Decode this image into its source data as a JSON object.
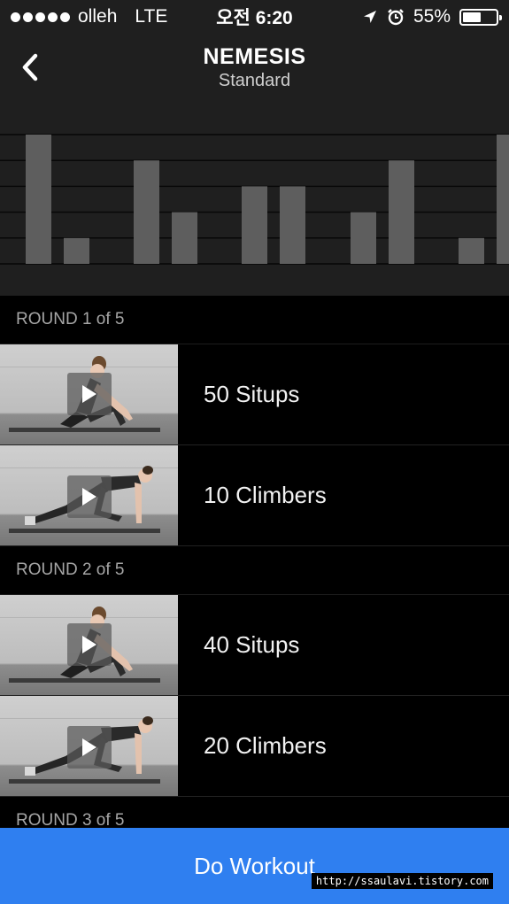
{
  "status_bar": {
    "carrier": "olleh",
    "network": "LTE",
    "time": "오전 6:20",
    "battery": "55%",
    "battery_level": 0.55,
    "icons": [
      "signal-dots-icon",
      "location-arrow-icon",
      "alarm-icon",
      "battery-icon"
    ]
  },
  "header": {
    "title": "NEMESIS",
    "subtitle": "Standard",
    "back_icon": "chevron-left-icon"
  },
  "chart_data": {
    "type": "bar",
    "title": "",
    "xlabel": "",
    "ylabel": "",
    "grid": true,
    "values": [
      5,
      1,
      4,
      2,
      3,
      3,
      2,
      4,
      1,
      5
    ],
    "ylim": [
      0,
      5
    ],
    "bar_color": "#5e5e5e"
  },
  "rounds": [
    {
      "label": "ROUND 1 of 5",
      "exercises": [
        {
          "label": "50 Situps",
          "kind": "situps"
        },
        {
          "label": "10 Climbers",
          "kind": "climbers"
        }
      ]
    },
    {
      "label": "ROUND 2 of 5",
      "exercises": [
        {
          "label": "40 Situps",
          "kind": "situps"
        },
        {
          "label": "20 Climbers",
          "kind": "climbers"
        }
      ]
    },
    {
      "label": "ROUND 3 of 5",
      "exercises": []
    }
  ],
  "footer": {
    "do_workout_label": "Do Workout",
    "accent_color": "#2f7ff0"
  },
  "watermark": "http://ssaulavi.tistory.com"
}
